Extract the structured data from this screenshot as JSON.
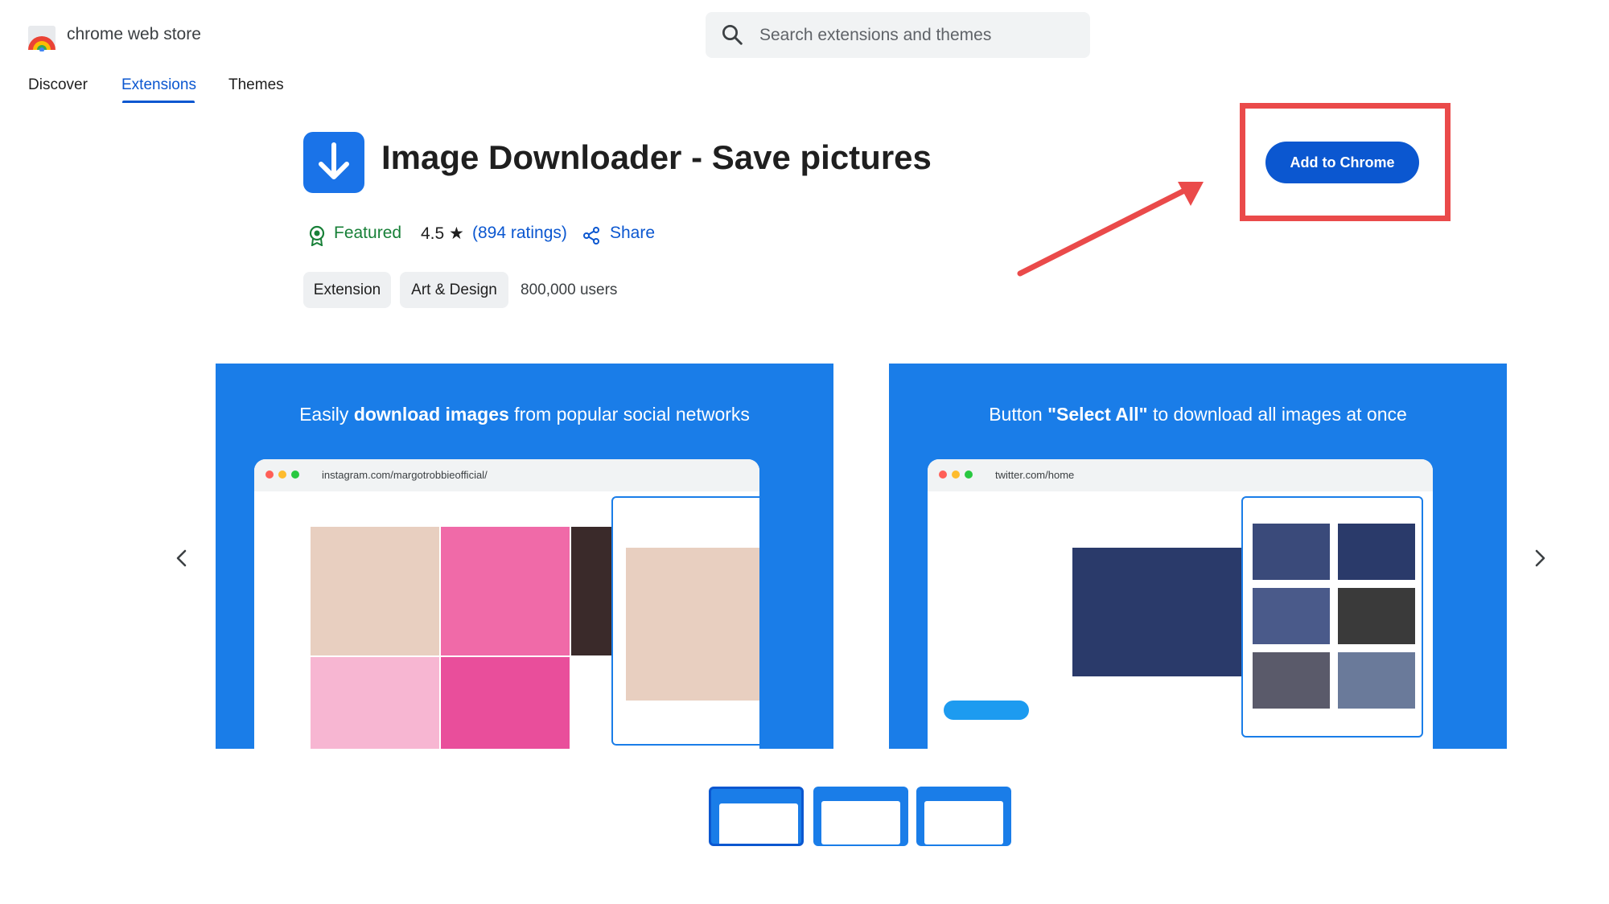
{
  "header": {
    "brand": "chrome web store",
    "search_placeholder": "Search extensions and themes"
  },
  "tabs": [
    {
      "label": "Discover"
    },
    {
      "label": "Extensions"
    },
    {
      "label": "Themes"
    }
  ],
  "extension": {
    "title": "Image Downloader - Save pictures",
    "featured": "Featured",
    "rating": "4.5 ★",
    "ratings_count": "(894 ratings)",
    "share": "Share",
    "chips": [
      "Extension",
      "Art & Design"
    ],
    "users": "800,000 users",
    "add_button": "Add to Chrome"
  },
  "slides": [
    {
      "caption_pre": "Easily ",
      "caption_bold": "download images",
      "caption_post": " from popular social networks",
      "url": "instagram.com/margotrobbieofficial/"
    },
    {
      "caption_pre": "Button ",
      "caption_bold": "\"Select All\"",
      "caption_post": " to download all images at once",
      "url": "twitter.com/home"
    }
  ],
  "icons": {
    "search": "search-icon",
    "featured": "badge-icon",
    "share": "share-icon",
    "prev": "chevron-left-icon",
    "next": "chevron-right-icon"
  },
  "colors": {
    "accent": "#0b57d0",
    "featured": "#188038",
    "highlight": "#ea4a4a",
    "slide_bg": "#1a7de8"
  }
}
